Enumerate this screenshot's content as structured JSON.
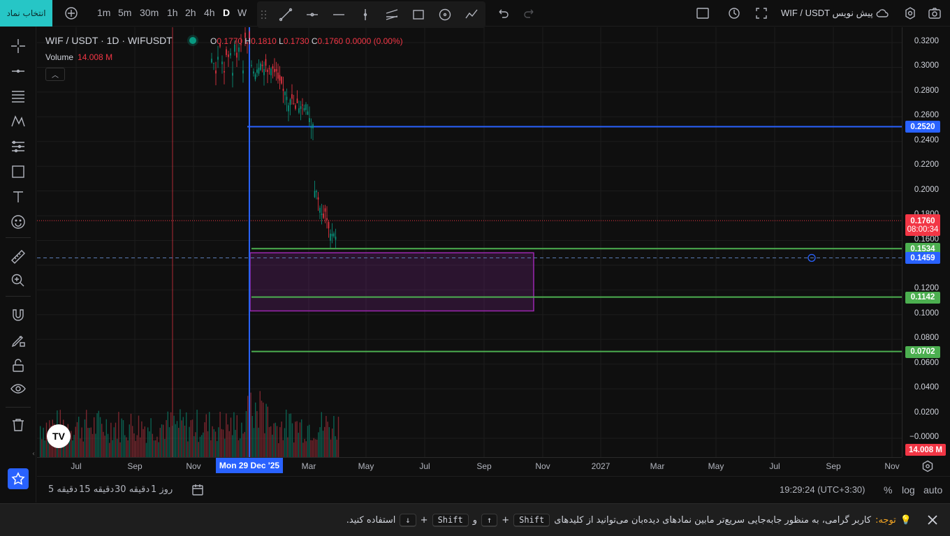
{
  "topbar": {
    "symbol_button": "انتخاب نماد",
    "timeframes": [
      "1m",
      "5m",
      "30m",
      "1h",
      "2h",
      "4h",
      "D",
      "W"
    ],
    "active_timeframe": "D",
    "title": "WIF / USDT پیش نویس"
  },
  "legend": {
    "symbol": "WIF / USDT · 1D · WIFUSDT",
    "o_label": "O",
    "o_value": "0.1770",
    "h_label": "H",
    "h_value": "0.1810",
    "l_label": "L",
    "l_value": "0.1730",
    "c_label": "C",
    "c_value": "0.1760",
    "change": "0.0000 (0.00%)",
    "volume_label": "Volume",
    "volume_value": "14.008 M"
  },
  "price_axis": {
    "labels": [
      "0.3200",
      "0.3000",
      "0.2800",
      "0.2600",
      "0.2400",
      "0.2200",
      "0.2000",
      "0.1800",
      "0.1600",
      "0.1200",
      "0.1000",
      "0.0800",
      "0.0600",
      "0.0400",
      "0.0200",
      "−0.0000"
    ],
    "badges": {
      "line_blue": "0.2520",
      "last_price": "0.1760",
      "countdown": "08:00:34",
      "line_green_1": "0.1534",
      "crosshair": "0.1459",
      "line_green_2": "0.1142",
      "line_green_3": "0.0702",
      "volume": "14.008 M"
    }
  },
  "time_axis": {
    "labels": [
      "Jul",
      "Sep",
      "Nov",
      "Mar",
      "May",
      "Jul",
      "Sep",
      "Nov",
      "2027",
      "Mar",
      "May",
      "Jul",
      "Sep",
      "Nov"
    ],
    "cursor_label": "Mon 29 Dec '25"
  },
  "rangebar": {
    "ranges": [
      "5 دقیقه",
      "15 دقیقه",
      "30 دقیقه",
      "1 روز"
    ],
    "clock": "19:29:24 (UTC+3:30)",
    "percent": "%",
    "log": "log",
    "auto": "auto"
  },
  "notice": {
    "label": "توجه:",
    "text": "کاربر گرامی، به منظور جابه‌جایی سریع‌تر مابین نمادهای دیده‌بان می‌توانید از کلیدهای",
    "key_shift_1": "Shift",
    "key_up": "↑",
    "and": "و",
    "key_shift_2": "Shift",
    "key_down": "↓",
    "tail": "استفاده کنید."
  },
  "colors": {
    "accent_blue": "#2962ff",
    "green_line": "#4caf50",
    "red": "#f23645",
    "teal": "#089981",
    "zone_purple": "#9c27b0"
  },
  "chart_data": {
    "type": "candlestick",
    "ylim": [
      -0.005,
      0.33
    ],
    "horizontal_lines": [
      {
        "price": 0.252,
        "color": "blue"
      },
      {
        "price": 0.1534,
        "color": "green"
      },
      {
        "price": 0.1142,
        "color": "green"
      },
      {
        "price": 0.0702,
        "color": "green"
      }
    ],
    "last_price": 0.176,
    "crosshair_price": 0.1459,
    "zone": {
      "top": 0.15,
      "bottom": 0.103
    },
    "vertical_line_label": "Mon 29 Dec '25"
  }
}
